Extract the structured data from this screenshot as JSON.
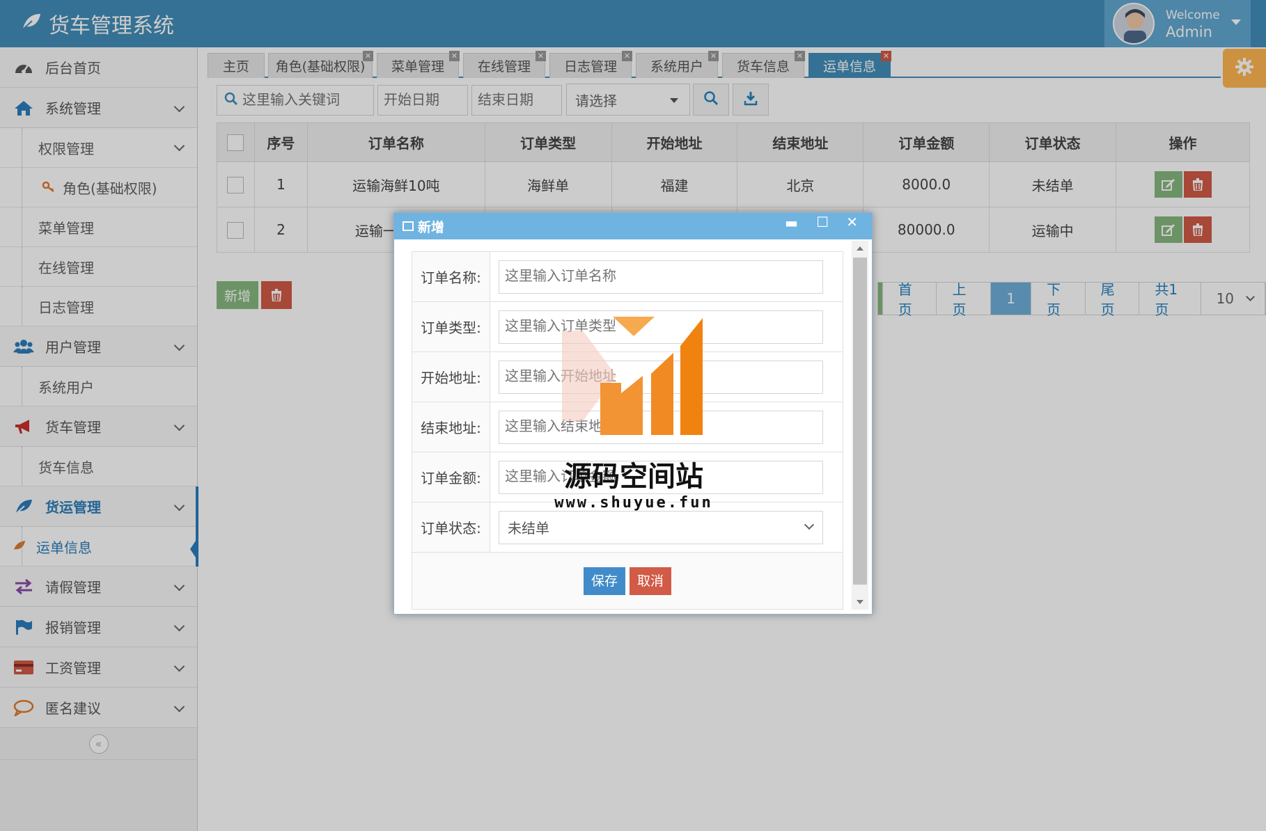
{
  "header": {
    "app_title": "货车管理系统",
    "welcome": "Welcome",
    "username": "Admin",
    "brand_color": "#438eb9"
  },
  "sidebar": {
    "items": [
      {
        "label": "后台首页",
        "icon": "dashboard-icon"
      },
      {
        "label": "系统管理",
        "icon": "home-icon"
      },
      {
        "label": "权限管理"
      },
      {
        "label": "角色(基础权限)",
        "icon": "key-icon"
      },
      {
        "label": "菜单管理"
      },
      {
        "label": "在线管理"
      },
      {
        "label": "日志管理"
      },
      {
        "label": "用户管理",
        "icon": "users-icon"
      },
      {
        "label": "系统用户"
      },
      {
        "label": "货车管理",
        "icon": "bullhorn-icon"
      },
      {
        "label": "货车信息"
      },
      {
        "label": "货运管理",
        "icon": "leaf-icon"
      },
      {
        "label": "运单信息",
        "icon": "leaf-icon"
      },
      {
        "label": "请假管理",
        "icon": "exchange-icon"
      },
      {
        "label": "报销管理",
        "icon": "flag-icon"
      },
      {
        "label": "工资管理",
        "icon": "credit-card-icon"
      },
      {
        "label": "匿名建议",
        "icon": "comment-icon"
      }
    ],
    "collapse_symbol": "«"
  },
  "tabs": [
    {
      "label": "主页"
    },
    {
      "label": "角色(基础权限)"
    },
    {
      "label": "菜单管理"
    },
    {
      "label": "在线管理"
    },
    {
      "label": "日志管理"
    },
    {
      "label": "系统用户"
    },
    {
      "label": "货车信息"
    },
    {
      "label": "运单信息",
      "active": true
    }
  ],
  "toolbar": {
    "search_placeholder": "这里输入关键词",
    "start_date_placeholder": "开始日期",
    "end_date_placeholder": "结束日期",
    "select_value": "请选择"
  },
  "table": {
    "columns": [
      "序号",
      "订单名称",
      "订单类型",
      "开始地址",
      "结束地址",
      "订单金额",
      "订单状态",
      "操作"
    ],
    "rows": [
      {
        "no": "1",
        "name": "运输海鲜10吨",
        "type": "海鲜单",
        "from": "福建",
        "to": "北京",
        "amount": "8000.0",
        "status": "未结单"
      },
      {
        "no": "2",
        "name": "运输一",
        "type": "",
        "from": "",
        "to": "",
        "amount": "80000.0",
        "status": "运输中"
      }
    ]
  },
  "actions": {
    "add_label": "新增"
  },
  "pager": {
    "first": "首页",
    "prev": "上页",
    "current": "1",
    "next": "下页",
    "last": "尾页",
    "total": "共1页",
    "page_size": "10"
  },
  "dialog": {
    "title": "新增",
    "fields": [
      {
        "label": "订单名称:",
        "placeholder": "这里输入订单名称"
      },
      {
        "label": "订单类型:",
        "placeholder": "这里输入订单类型"
      },
      {
        "label": "开始地址:",
        "placeholder": "这里输入开始地址"
      },
      {
        "label": "结束地址:",
        "placeholder": "这里输入结束地址"
      },
      {
        "label": "订单金额:",
        "placeholder": "这里输入订单金额"
      }
    ],
    "status_label": "订单状态:",
    "status_value": "未结单",
    "save_label": "保存",
    "cancel_label": "取消"
  },
  "watermark": {
    "text": "源码空间站",
    "url": "www.shuyue.fun"
  }
}
